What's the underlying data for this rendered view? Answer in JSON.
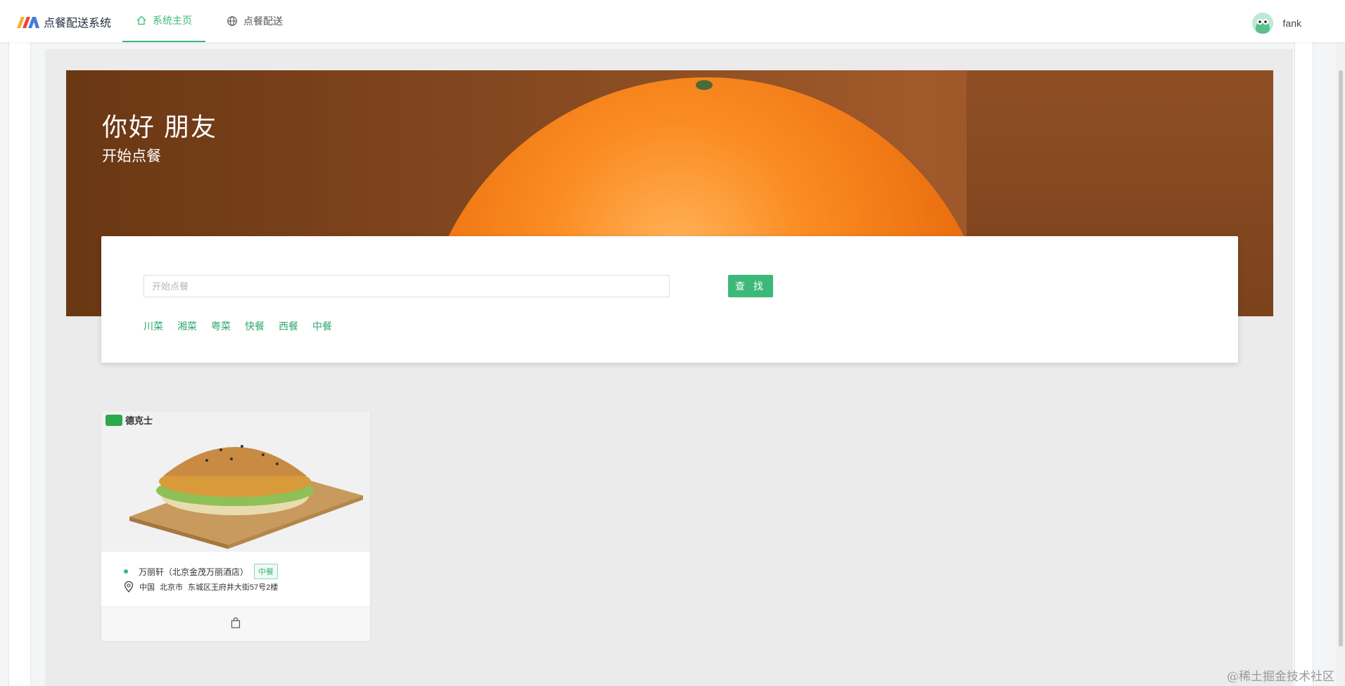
{
  "app": {
    "title": "点餐配送系统"
  },
  "nav": {
    "home_label": "系统主页",
    "delivery_label": "点餐配送"
  },
  "user": {
    "name": "fank"
  },
  "hero": {
    "title": "你好  朋友",
    "subtitle": "开始点餐"
  },
  "search": {
    "placeholder": "开始点餐",
    "value": "",
    "button_label": "查 找"
  },
  "categories": [
    "川菜",
    "湘菜",
    "粤菜",
    "快餐",
    "西餐",
    "中餐"
  ],
  "restaurants": [
    {
      "brand": "德克士",
      "name": "万丽轩（北京金茂万丽酒店）",
      "tag": "中餐",
      "address": {
        "country": "中国",
        "city": "北京市",
        "street": "东城区王府井大街57号2楼"
      }
    }
  ],
  "watermark": "@稀土掘金技术社区",
  "colors": {
    "accent": "#3cb879"
  }
}
